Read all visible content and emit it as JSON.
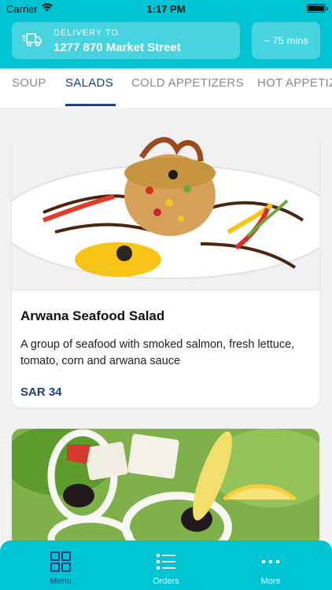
{
  "status_bar": {
    "carrier": "Carrier",
    "time": "1:17 PM"
  },
  "header": {
    "delivery_label": "DELIVERY TO",
    "delivery_address": "1277 870 Market Street",
    "eta": "~ 75 mins"
  },
  "tabs": [
    {
      "label": "SOUP"
    },
    {
      "label": "SALADS"
    },
    {
      "label": "COLD APPETIZERS"
    },
    {
      "label": "HOT APPETIZ"
    }
  ],
  "active_tab": "SALADS",
  "items": [
    {
      "title": "Arwana Seafood Salad",
      "description": "A group of seafood with smoked salmon, fresh lettuce, tomato, corn and arwana sauce",
      "price": "SAR 34"
    }
  ],
  "bottom_nav": [
    {
      "label": "Menu",
      "icon": "grid-icon"
    },
    {
      "label": "Orders",
      "icon": "list-icon"
    },
    {
      "label": "More",
      "icon": "more-icon"
    }
  ],
  "colors": {
    "accent": "#00c4d4",
    "primary": "#1f3f7a"
  }
}
